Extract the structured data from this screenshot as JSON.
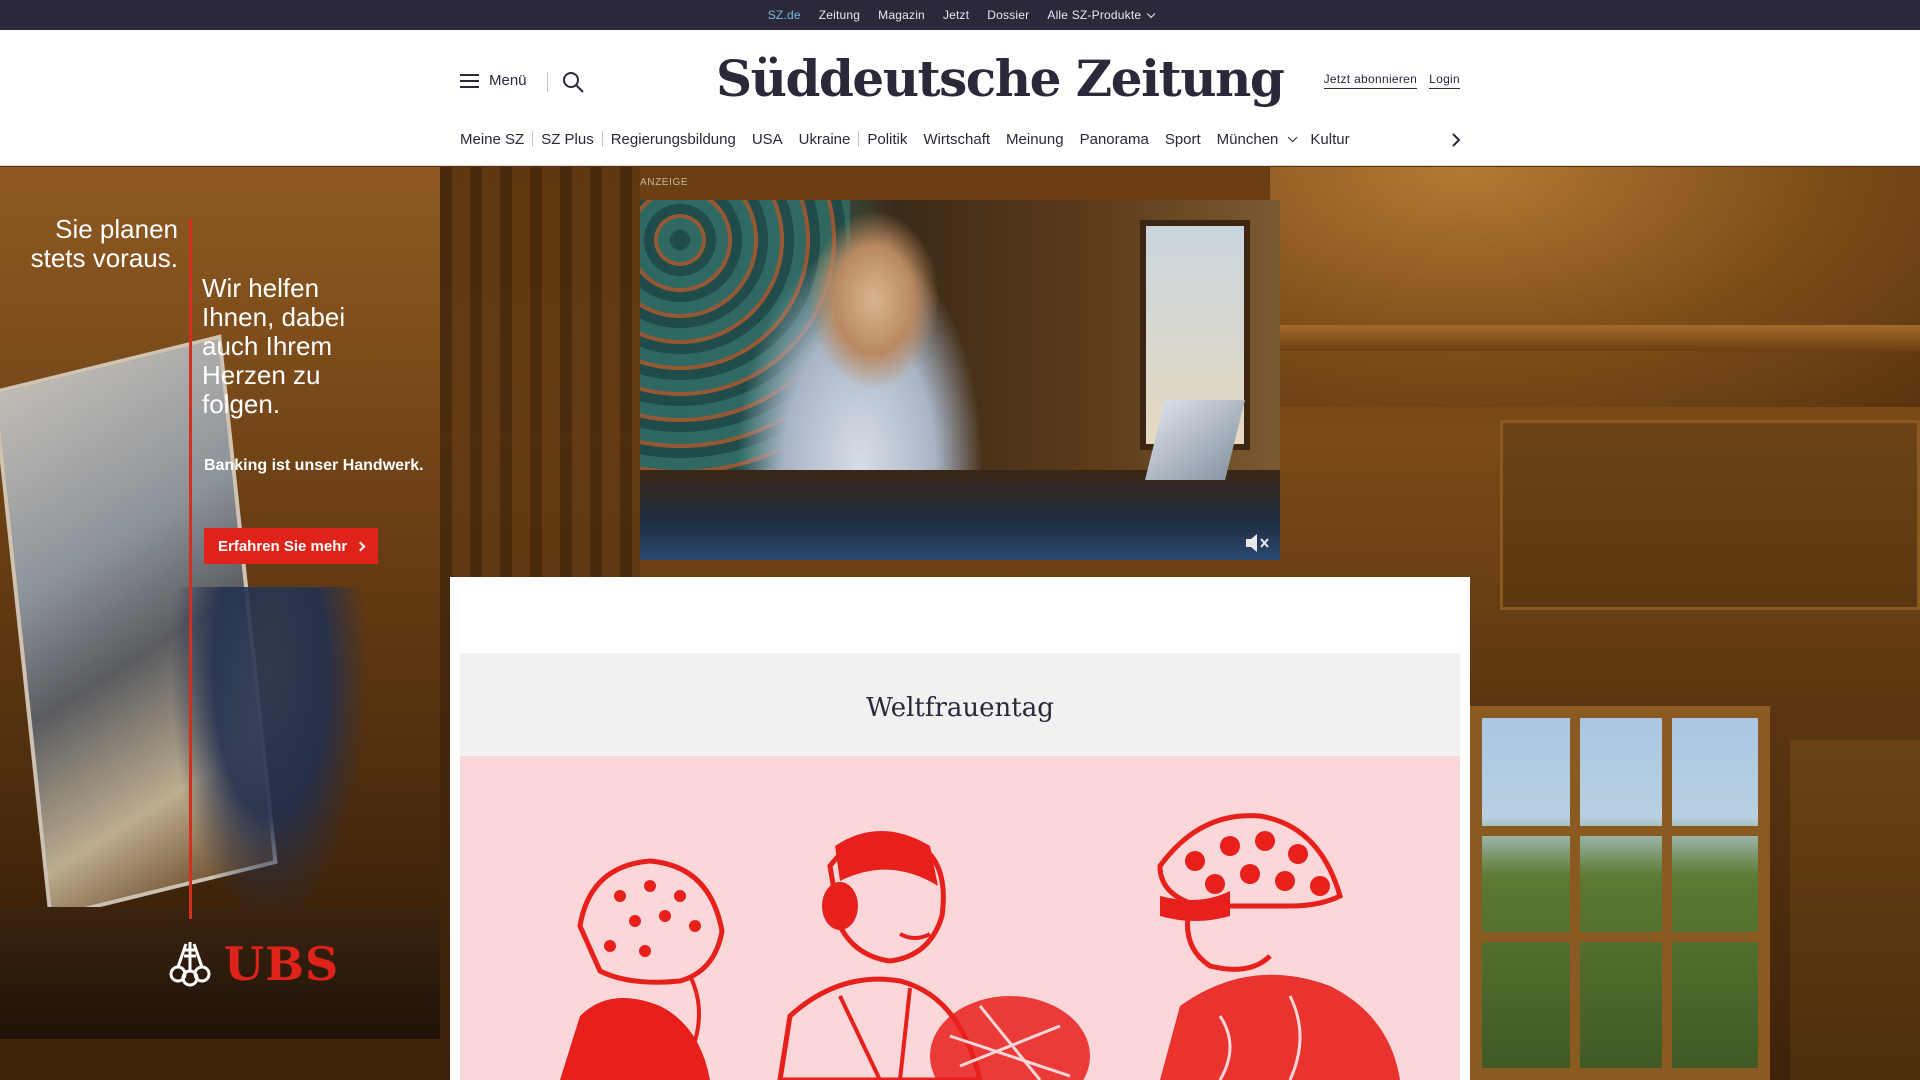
{
  "topbar": {
    "links": [
      {
        "label": "SZ.de",
        "active": true
      },
      {
        "label": "Zeitung"
      },
      {
        "label": "Magazin"
      },
      {
        "label": "Jetzt"
      },
      {
        "label": "Dossier"
      },
      {
        "label": "Alle SZ-Produkte",
        "dropdown": true
      }
    ]
  },
  "header": {
    "menu_label": "Menü",
    "logo_text": "Süddeutsche Zeitung",
    "subscribe_label": "Jetzt abonnieren",
    "login_label": "Login",
    "icons": {
      "menu": "hamburger-icon",
      "search": "search-icon",
      "next": "chevron-right-icon"
    }
  },
  "nav": {
    "items": [
      {
        "label": "Meine SZ"
      },
      {
        "label": "SZ Plus"
      },
      {
        "label": "Regierungsbildung"
      },
      {
        "label": "USA"
      },
      {
        "label": "Ukraine"
      },
      {
        "label": "Politik"
      },
      {
        "label": "Wirtschaft"
      },
      {
        "label": "Meinung"
      },
      {
        "label": "Panorama"
      },
      {
        "label": "Sport"
      },
      {
        "label": "München",
        "dropdown": true
      },
      {
        "label": "Kultur"
      }
    ]
  },
  "ad_left": {
    "tagline_1": "Sie planen stets voraus.",
    "tagline_2": "Wir helfen Ihnen, dabei auch Ihrem Herzen zu folgen.",
    "tagline_3": "Banking ist unser Handwerk.",
    "cta_label": "Erfahren Sie mehr",
    "brand": "UBS",
    "brand_color": "#e0231a"
  },
  "video_ad": {
    "label": "ANZEIGE",
    "mute_icon": "speaker-muted-icon"
  },
  "section": {
    "title": "Weltfrauentag"
  },
  "colors": {
    "topbar_bg": "#29293a",
    "topbar_active": "#7fb6d8",
    "text": "#29293a",
    "illustration_bg": "#fbd7da",
    "illustration_ink": "#e8201c"
  }
}
